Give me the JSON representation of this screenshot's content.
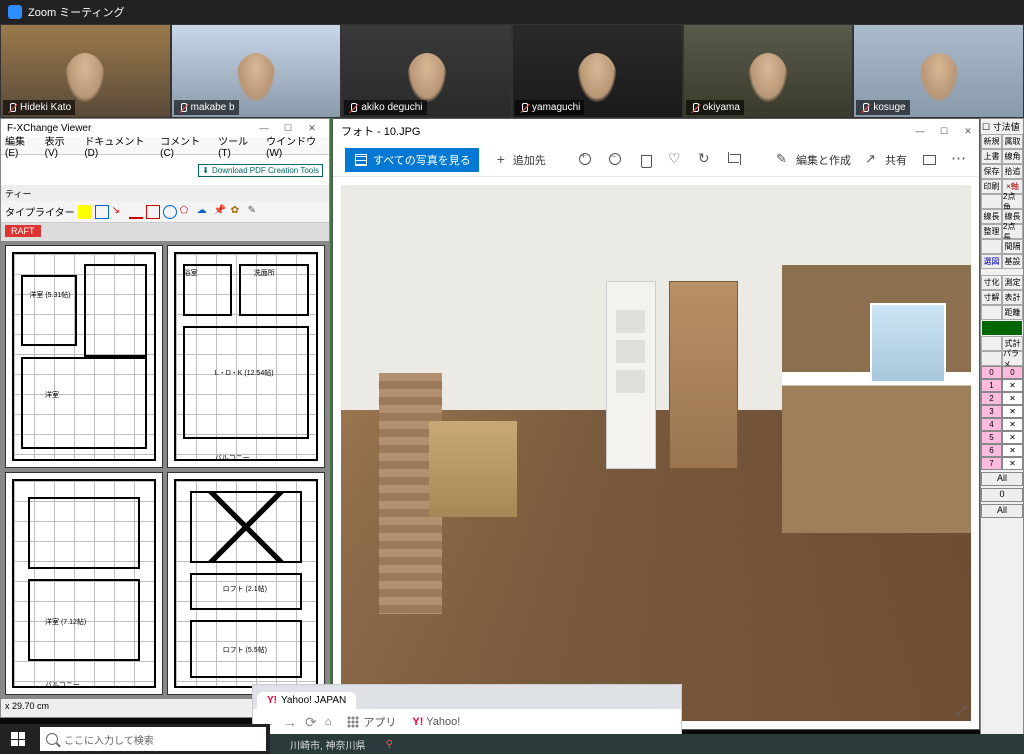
{
  "zoom": {
    "title": "Zoom ミーティング",
    "participants": [
      {
        "name": "Hideki Kato"
      },
      {
        "name": "makabe b"
      },
      {
        "name": "akiko deguchi"
      },
      {
        "name": "yamaguchi"
      },
      {
        "name": "okiyama"
      },
      {
        "name": "kosuge"
      }
    ]
  },
  "pdf": {
    "title": "F-XChange Viewer",
    "menu": [
      "編集(E)",
      "表示(V)",
      "ドキュメント(D)",
      "コメント(C)",
      "ツール(T)",
      "ウインドウ(W)"
    ],
    "creation_badge": "Download PDF Creation Tools",
    "subbar": "ティー",
    "typewriter_label": "タイプライター",
    "tab_label": "RAFT",
    "floorplan_labels": {
      "room1": "洋室 (5.31帖)",
      "room2": "洗面所",
      "room3": "浴室",
      "ldk": "L・D・K (12.54帖)",
      "balcony": "バルコニー",
      "room4": "洋室 (7.12帖)",
      "loft1": "ロフト (2.1帖)",
      "loft2": "ロフト (5.5帖)",
      "room5": "洋室"
    },
    "status": "x 29.70 cm"
  },
  "photos": {
    "title": "フォト - 10.JPG",
    "all_photos": "すべての写真を見る",
    "add_to": "追加先",
    "edit_create": "編集と作成",
    "share": "共有"
  },
  "cad": {
    "size_lock": "寸法値",
    "buttons_l": [
      "新規",
      "上書",
      "保存",
      "印刷",
      "",
      "線長",
      "整理",
      "",
      "選図",
      ""
    ],
    "buttons_r": [
      "属取",
      "線角",
      "拾追",
      "×軸",
      "2点角",
      "線長",
      "2点長",
      "間隔",
      "基設",
      ""
    ],
    "mid_l": [
      "寸化",
      "寸解"
    ],
    "mid_r": [
      "測定",
      "表計",
      "距離"
    ],
    "green_label": "式計",
    "param": "パラメ",
    "nums": [
      "0",
      "1",
      "2",
      "3",
      "4",
      "5",
      "6",
      "7"
    ],
    "all": "All"
  },
  "browser": {
    "tab": "Yahoo! JAPAN",
    "apps": "アプリ",
    "yahoo_short": "Yahoo!"
  },
  "map": {
    "location": "川崎市, 神奈川県"
  },
  "taskbar": {
    "search_placeholder": "ここに入力して検索"
  }
}
